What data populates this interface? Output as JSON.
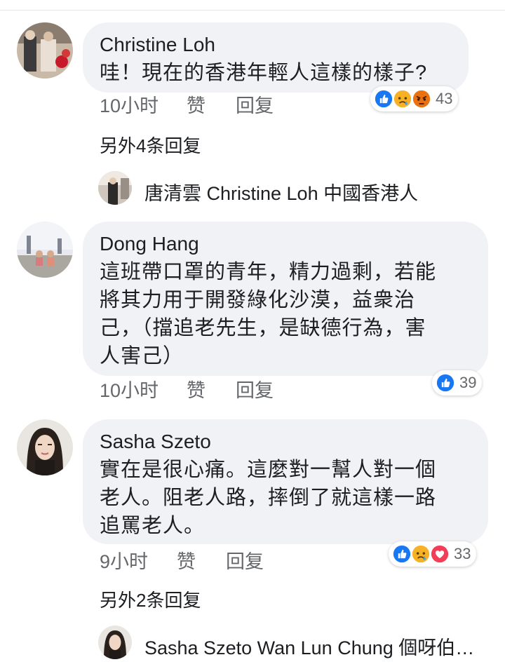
{
  "comments": [
    {
      "author": "Christine Loh",
      "lines": [
        "哇！現在的香港年輕人這樣的樣子?"
      ],
      "time": "10小时",
      "like": "赞",
      "reply": "回复",
      "reaction_count": "43",
      "reactions": [
        "like-icon",
        "sad-icon",
        "angry-icon"
      ],
      "more_replies": "另外4条回复",
      "reply_preview": {
        "name": "唐清雲 Christine Loh 中國香港人",
        "text": ""
      }
    },
    {
      "author": "Dong Hang",
      "lines": [
        "這班帶口罩的青年，精力過剩，若能",
        "將其力用于開發綠化沙漠，益衆治",
        "己，（擋追老先生，是缺德行為，害",
        "人害己）"
      ],
      "time": "10小时",
      "like": "赞",
      "reply": "回复",
      "reaction_count": "39",
      "reactions": [
        "like-icon"
      ]
    },
    {
      "author": "Sasha Szeto",
      "lines": [
        "實在是很心痛。這麼對一幫人對一個",
        "老人。阻老人路，摔倒了就這樣一路",
        "追罵老人。"
      ],
      "time": "9小时",
      "like": "赞",
      "reply": "回复",
      "reaction_count": "33",
      "reactions": [
        "like-icon",
        "sad-icon",
        "love-icon"
      ],
      "more_replies": "另外2条回复",
      "reply_preview": {
        "name": "Sasha Szeto",
        "text": "Wan Lun Chung 個呀伯…"
      }
    }
  ],
  "colors": {
    "bubble": "#f0f2f5",
    "meta": "#65676b",
    "like": "#1877f2",
    "love": "#f33e58",
    "sad": "#f7b125",
    "angry": "#e9710f"
  }
}
